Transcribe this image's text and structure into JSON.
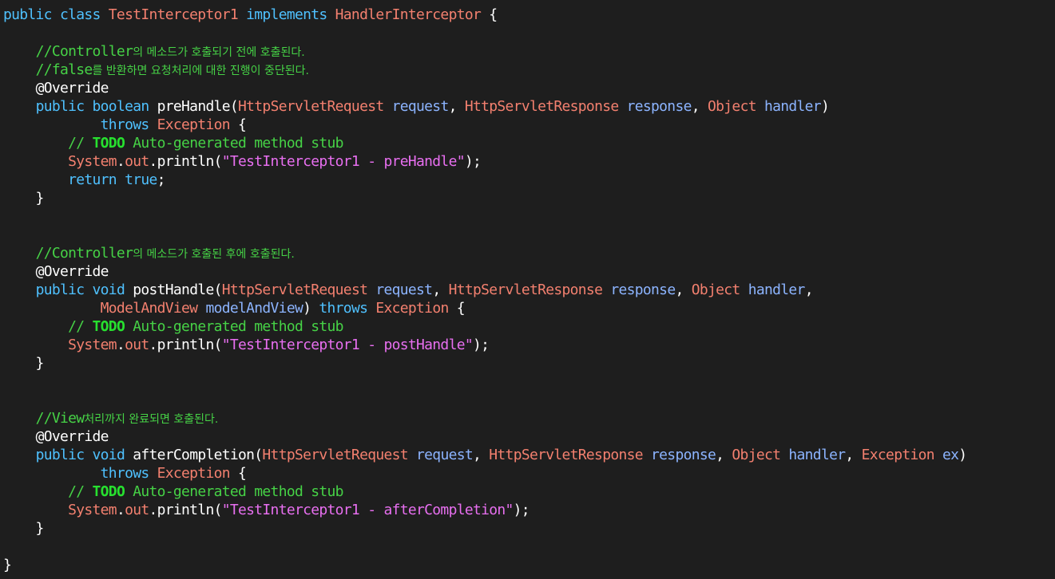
{
  "editor": {
    "background": "#1e1e1e",
    "colors": {
      "keyword": "#4fc1ff",
      "type": "#f3806f",
      "parameter": "#8cb4ff",
      "string": "#e86ff0",
      "comment": "#46d246",
      "todo": "#27e02f",
      "plain": "#ffffff"
    },
    "lines": [
      [
        {
          "t": "public",
          "c": "kw"
        },
        {
          "t": " "
        },
        {
          "t": "class",
          "c": "kw"
        },
        {
          "t": " "
        },
        {
          "t": "TestInterceptor1",
          "c": "cls"
        },
        {
          "t": " "
        },
        {
          "t": "implements",
          "c": "kw"
        },
        {
          "t": " "
        },
        {
          "t": "HandlerInterceptor",
          "c": "cls"
        },
        {
          "t": " {"
        }
      ],
      [],
      [
        {
          "t": "    "
        },
        {
          "t": "//Controller",
          "c": "comment"
        },
        {
          "t": "의 메소드가 호출되기 전에 호출된다.",
          "c": "comment",
          "ko": true
        }
      ],
      [
        {
          "t": "    "
        },
        {
          "t": "//false",
          "c": "comment"
        },
        {
          "t": "를 반환하면 요청처리에 대한 진행이 중단된다.",
          "c": "comment",
          "ko": true
        }
      ],
      [
        {
          "t": "    "
        },
        {
          "t": "@Override",
          "c": "ann"
        }
      ],
      [
        {
          "t": "    "
        },
        {
          "t": "public",
          "c": "kw"
        },
        {
          "t": " "
        },
        {
          "t": "boolean",
          "c": "kw"
        },
        {
          "t": " preHandle("
        },
        {
          "t": "HttpServletRequest",
          "c": "type"
        },
        {
          "t": " "
        },
        {
          "t": "request",
          "c": "param"
        },
        {
          "t": ", "
        },
        {
          "t": "HttpServletResponse",
          "c": "type"
        },
        {
          "t": " "
        },
        {
          "t": "response",
          "c": "param"
        },
        {
          "t": ", "
        },
        {
          "t": "Object",
          "c": "type"
        },
        {
          "t": " "
        },
        {
          "t": "handler",
          "c": "param"
        },
        {
          "t": ")"
        }
      ],
      [
        {
          "t": "            "
        },
        {
          "t": "throws",
          "c": "kw"
        },
        {
          "t": " "
        },
        {
          "t": "Exception",
          "c": "type"
        },
        {
          "t": " {"
        }
      ],
      [
        {
          "t": "        "
        },
        {
          "t": "// ",
          "c": "comment"
        },
        {
          "t": "TODO",
          "c": "todo"
        },
        {
          "t": " Auto-generated method stub",
          "c": "comment"
        }
      ],
      [
        {
          "t": "        "
        },
        {
          "t": "System",
          "c": "type"
        },
        {
          "t": "."
        },
        {
          "t": "out",
          "c": "field"
        },
        {
          "t": ".println("
        },
        {
          "t": "\"TestInterceptor1 - preHandle\"",
          "c": "str"
        },
        {
          "t": ");"
        }
      ],
      [
        {
          "t": "        "
        },
        {
          "t": "return",
          "c": "kw"
        },
        {
          "t": " "
        },
        {
          "t": "true",
          "c": "kw"
        },
        {
          "t": ";"
        }
      ],
      [
        {
          "t": "    }"
        }
      ],
      [],
      [],
      [
        {
          "t": "    "
        },
        {
          "t": "//Controller",
          "c": "comment"
        },
        {
          "t": "의 메소드가 호출된 후에 호출된다.",
          "c": "comment",
          "ko": true
        }
      ],
      [
        {
          "t": "    "
        },
        {
          "t": "@Override",
          "c": "ann"
        }
      ],
      [
        {
          "t": "    "
        },
        {
          "t": "public",
          "c": "kw"
        },
        {
          "t": " "
        },
        {
          "t": "void",
          "c": "kw"
        },
        {
          "t": " postHandle("
        },
        {
          "t": "HttpServletRequest",
          "c": "type"
        },
        {
          "t": " "
        },
        {
          "t": "request",
          "c": "param"
        },
        {
          "t": ", "
        },
        {
          "t": "HttpServletResponse",
          "c": "type"
        },
        {
          "t": " "
        },
        {
          "t": "response",
          "c": "param"
        },
        {
          "t": ", "
        },
        {
          "t": "Object",
          "c": "type"
        },
        {
          "t": " "
        },
        {
          "t": "handler",
          "c": "param"
        },
        {
          "t": ","
        }
      ],
      [
        {
          "t": "            "
        },
        {
          "t": "ModelAndView",
          "c": "type"
        },
        {
          "t": " "
        },
        {
          "t": "modelAndView",
          "c": "param"
        },
        {
          "t": ") "
        },
        {
          "t": "throws",
          "c": "kw"
        },
        {
          "t": " "
        },
        {
          "t": "Exception",
          "c": "type"
        },
        {
          "t": " {"
        }
      ],
      [
        {
          "t": "        "
        },
        {
          "t": "// ",
          "c": "comment"
        },
        {
          "t": "TODO",
          "c": "todo"
        },
        {
          "t": " Auto-generated method stub",
          "c": "comment"
        }
      ],
      [
        {
          "t": "        "
        },
        {
          "t": "System",
          "c": "type"
        },
        {
          "t": "."
        },
        {
          "t": "out",
          "c": "field"
        },
        {
          "t": ".println("
        },
        {
          "t": "\"TestInterceptor1 - postHandle\"",
          "c": "str"
        },
        {
          "t": ");"
        }
      ],
      [
        {
          "t": "    }"
        }
      ],
      [],
      [],
      [
        {
          "t": "    "
        },
        {
          "t": "//View",
          "c": "comment"
        },
        {
          "t": "처리까지 완료되면 호출된다.",
          "c": "comment",
          "ko": true
        }
      ],
      [
        {
          "t": "    "
        },
        {
          "t": "@Override",
          "c": "ann"
        }
      ],
      [
        {
          "t": "    "
        },
        {
          "t": "public",
          "c": "kw"
        },
        {
          "t": " "
        },
        {
          "t": "void",
          "c": "kw"
        },
        {
          "t": " afterCompletion("
        },
        {
          "t": "HttpServletRequest",
          "c": "type"
        },
        {
          "t": " "
        },
        {
          "t": "request",
          "c": "param"
        },
        {
          "t": ", "
        },
        {
          "t": "HttpServletResponse",
          "c": "type"
        },
        {
          "t": " "
        },
        {
          "t": "response",
          "c": "param"
        },
        {
          "t": ", "
        },
        {
          "t": "Object",
          "c": "type"
        },
        {
          "t": " "
        },
        {
          "t": "handler",
          "c": "param"
        },
        {
          "t": ", "
        },
        {
          "t": "Exception",
          "c": "type"
        },
        {
          "t": " "
        },
        {
          "t": "ex",
          "c": "param"
        },
        {
          "t": ")"
        }
      ],
      [
        {
          "t": "            "
        },
        {
          "t": "throws",
          "c": "kw"
        },
        {
          "t": " "
        },
        {
          "t": "Exception",
          "c": "type"
        },
        {
          "t": " {"
        }
      ],
      [
        {
          "t": "        "
        },
        {
          "t": "// ",
          "c": "comment"
        },
        {
          "t": "TODO",
          "c": "todo"
        },
        {
          "t": " Auto-generated method stub",
          "c": "comment"
        }
      ],
      [
        {
          "t": "        "
        },
        {
          "t": "System",
          "c": "type"
        },
        {
          "t": "."
        },
        {
          "t": "out",
          "c": "field"
        },
        {
          "t": ".println("
        },
        {
          "t": "\"TestInterceptor1 - afterCompletion\"",
          "c": "str"
        },
        {
          "t": ");"
        }
      ],
      [
        {
          "t": "    }"
        }
      ],
      [],
      [
        {
          "t": "}"
        }
      ]
    ]
  }
}
